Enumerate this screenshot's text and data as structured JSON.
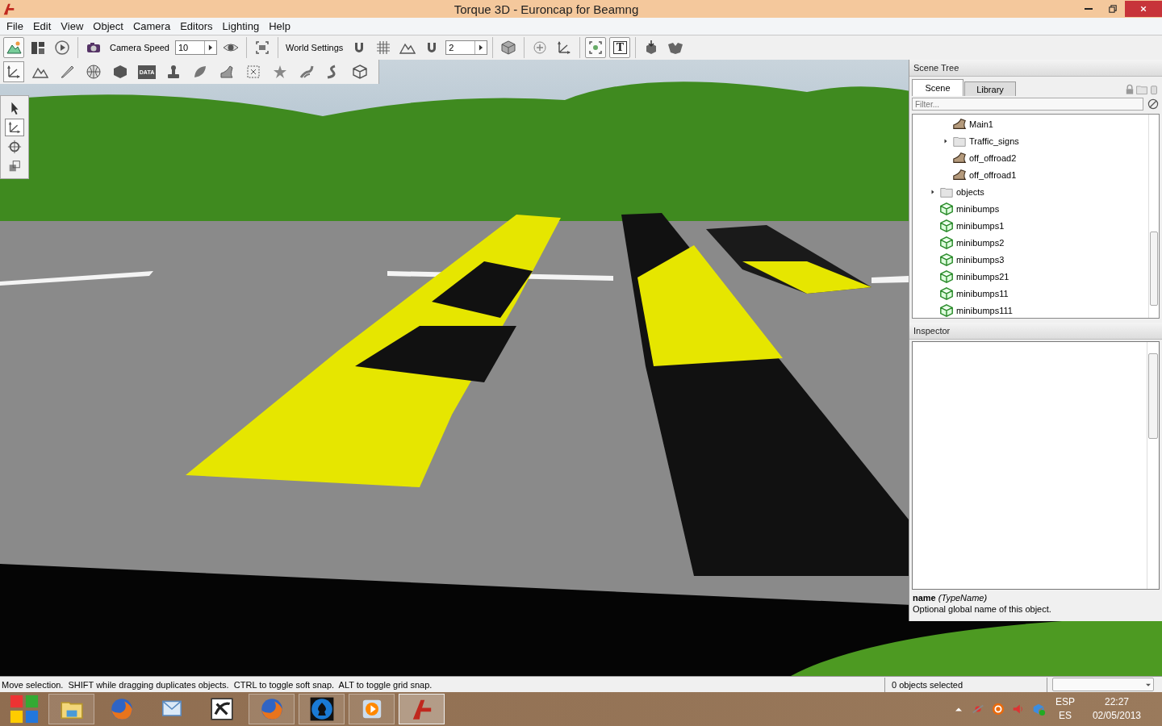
{
  "window": {
    "title": "Torque 3D - Euroncap for Beamng"
  },
  "menu": [
    "File",
    "Edit",
    "View",
    "Object",
    "Camera",
    "Editors",
    "Lighting",
    "Help"
  ],
  "toolbar": [
    {
      "kind": "button",
      "pressed": true
    },
    {
      "kind": "button",
      "pressed": false
    },
    {
      "kind": "button",
      "pressed": false
    },
    {
      "kind": "separator"
    },
    {
      "kind": "button",
      "pressed": false
    },
    {
      "kind": "label",
      "text": "Camera Speed"
    },
    {
      "kind": "spin",
      "value": "10"
    },
    {
      "kind": "button",
      "pressed": false
    },
    {
      "kind": "separator"
    },
    {
      "kind": "button",
      "pressed": false
    },
    {
      "kind": "separator"
    },
    {
      "kind": "label",
      "text": "World Settings"
    },
    {
      "kind": "button",
      "pressed": false
    },
    {
      "kind": "button",
      "pressed": false
    },
    {
      "kind": "button",
      "pressed": false
    },
    {
      "kind": "button",
      "pressed": false
    },
    {
      "kind": "spin",
      "value": "2"
    },
    {
      "kind": "separator"
    },
    {
      "kind": "button",
      "pressed": false
    },
    {
      "kind": "separator"
    },
    {
      "kind": "button",
      "pressed": false
    },
    {
      "kind": "button",
      "pressed": false
    },
    {
      "kind": "separator"
    },
    {
      "kind": "button",
      "pressed": true
    },
    {
      "kind": "button",
      "pressed": true,
      "text": "T"
    },
    {
      "kind": "separator"
    },
    {
      "kind": "button",
      "pressed": false
    },
    {
      "kind": "button",
      "pressed": false
    }
  ],
  "editor_toolbar": [
    {
      "pressed": true
    },
    {
      "pressed": false
    },
    {
      "pressed": false
    },
    {
      "pressed": false
    },
    {
      "pressed": false
    },
    {
      "pressed": false,
      "text": "DATA"
    },
    {
      "pressed": false
    },
    {
      "pressed": false
    },
    {
      "pressed": false
    },
    {
      "pressed": false
    },
    {
      "pressed": false
    },
    {
      "pressed": false
    },
    {
      "pressed": false
    },
    {
      "pressed": false
    }
  ],
  "tool_palette": [
    {
      "selected": false
    },
    {
      "selected": true
    },
    {
      "selected": false
    },
    {
      "selected": false
    }
  ],
  "scene_tree": {
    "title": "Scene Tree",
    "tabs": [
      {
        "label": "Scene",
        "selected": true
      },
      {
        "label": "Library",
        "selected": false
      }
    ],
    "filter": {
      "placeholder": "Filter..."
    },
    "scrolled_branch_children": [
      {
        "label": "Main1",
        "kind": "road"
      },
      {
        "label": "Traffic_signs",
        "kind": "folder",
        "expanded": false
      },
      {
        "label": "off_offroad2",
        "kind": "road"
      },
      {
        "label": "off_offroad1",
        "kind": "road"
      }
    ],
    "items": [
      {
        "label": "objects",
        "kind": "folder",
        "expanded": false
      },
      {
        "label": "minibumps",
        "kind": "shape"
      },
      {
        "label": "minibumps1",
        "kind": "shape"
      },
      {
        "label": "minibumps2",
        "kind": "shape"
      },
      {
        "label": "minibumps3",
        "kind": "shape"
      },
      {
        "label": "minibumps21",
        "kind": "shape"
      },
      {
        "label": "minibumps11",
        "kind": "shape"
      },
      {
        "label": "minibumps111",
        "kind": "shape"
      }
    ]
  },
  "inspector": {
    "title": "Inspector",
    "field_help": "**name** *(TypeName)*",
    "description": "Optional global name of this object."
  },
  "status_bar": {
    "hint": "Move selection.  SHIFT while dragging duplicates objects.  CTRL to toggle soft snap.  ALT to toggle grid snap.",
    "selection": "0 objects selected"
  },
  "taskbar": {
    "apps": [
      {
        "running": true,
        "selected": false
      },
      {
        "running": false,
        "selected": false
      },
      {
        "running": false,
        "selected": false
      },
      {
        "running": false,
        "selected": false
      },
      {
        "running": true,
        "selected": false
      },
      {
        "running": true,
        "selected": false
      },
      {
        "running": true,
        "selected": false
      },
      {
        "running": true,
        "selected": true
      }
    ],
    "language": "ESP",
    "layout": "ES",
    "time": "22:27",
    "date": "02/05/2013"
  }
}
